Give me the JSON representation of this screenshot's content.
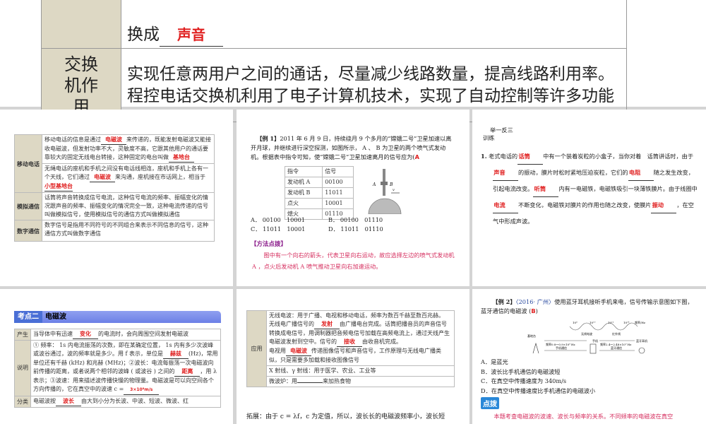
{
  "top_table": {
    "row0_tail": "换成",
    "row0_answer": "声音",
    "row1_header": "交换机作用",
    "row1_text": "实现任意两用户之间的通话，尽量减少线路数量，提高线路利用率。程控电话交换机利用了电子计算机技术，实现了自动控制等许多功能"
  },
  "slide1": {
    "rows": [
      {
        "header": "移动电话",
        "cells": [
          {
            "a": "移动电话的信息是通过",
            "ans1": "电磁波",
            "b": "来传递的，既能发射电磁波又能接收电磁波，但发射功率不大，灵敏度不高，它跟其他用户的通话要靠较大的固定无线电台转接，这种固定的电台叫做",
            "ans2": "基地台"
          },
          {
            "a": "无绳电话的座机和手机之间没有电话线相连，座机和手机上各有一个天线，它们通过",
            "ans1": "电磁波",
            "b": "来沟通，座机接在市话网上，相当于",
            "ans2": "小型基地台"
          }
        ]
      },
      {
        "header": "模拟通信",
        "text": "话筒将声音转换成信号电流，这种信号电流的频率、振幅变化的情况跟声音的频率、振幅变化的情况完全一致，这种电流传递的信号叫做模拟信号，使用模拟信号的通信方式叫做模拟通信"
      },
      {
        "header": "数字通信",
        "text": "数字信号是指用不同符号的不同组合来表示不同信息的信号，这种通信方式叫做数字通信"
      }
    ]
  },
  "slide2": {
    "label": "【例 1】",
    "stem": "2011 年 6 月 9 日，持续绕月 9 个多月的“嫦娥二号”卫星加速以离开月球，并继续进行深空探测，如图所示， A 、 B 为卫星的两个喷气式发动机。根据表中指令可知，使“嫦娥二号”卫星加速离月的信号应为(",
    "answer": "A",
    "close": ")",
    "table_headers": [
      "指令",
      "信号"
    ],
    "table_rows": [
      [
        "发动机 A",
        "00100"
      ],
      [
        "发动机 B",
        "11011"
      ],
      [
        "点火",
        "10001"
      ],
      [
        "熄火",
        "01110"
      ]
    ],
    "figure_labels": {
      "a": "A",
      "b": "B",
      "v": "v"
    },
    "options": [
      {
        "k": "A．",
        "v1": "00100",
        "v2": "10001"
      },
      {
        "k": "B．",
        "v1": "00100",
        "v2": "01110"
      },
      {
        "k": "C．",
        "v1": "11011",
        "v2": "10001"
      },
      {
        "k": "D．",
        "v1": "11011",
        "v2": "01110"
      }
    ],
    "method_title": "【方法点拨】",
    "method_text": "图中有一个向右的箭头，代表卫星向右运动，故应选择左边的喷气式发动机 A ，点火后发动机 A 喷气推动卫星向右加速运动。"
  },
  "slide3": {
    "heading1": "举一反三",
    "heading2": "训练",
    "num": "1.",
    "parts": [
      "老式电话的",
      "中有一个装着炭粒的小盒子，当你对着　话筒讲话时，由于",
      "的振动，膜片时松时紧地压迫炭粒，它们的",
      "随之发生改变，引起电流改变。",
      "内有一电磁铁，电磁铁吸引一块薄铁膜片。由于线圈中",
      "不断变化，电磁铁对膜片的作用也随之改变，使膜片",
      "，在空气中形成声波。"
    ],
    "answers": [
      "话筒",
      "声音",
      "电阻",
      "听筒",
      "电流",
      "振动"
    ]
  },
  "slide4": {
    "tag": "考点二",
    "title": "电磁波",
    "rows": [
      {
        "header": "产生",
        "a": "当导体中有迅速",
        "ans": "变化",
        "b": "的电流时，会向周围空间发射电磁波"
      },
      {
        "header": "说明",
        "a": "① 频率： 1s 内电流振荡的次数，即在某确定位置， 1s 内有多少次波峰或波谷通过，波的频率就是多少。用 f 表示，单位是",
        "ans1": "赫兹",
        "b": "(Hz)，常用单位还有千赫 (kHz) 和兆赫 (MHz)；②波长：电流每振荡一次电磁波向前传播的距离，或者说两个相邻的波峰 ( 或波谷 ) 之间的",
        "ans2": "距离",
        "c": "，用 λ 表示；③波速：用来描述波传播快慢的物理量。电磁波是可以向空间各个方向传播的，它在真空中的波速 c =",
        "ans3": "3×10⁸m/s"
      },
      {
        "header": "分类",
        "a": "电磁波按",
        "ans": "波长",
        "b": "由大到小分为长波、中波、短波、微波、红"
      }
    ]
  },
  "slide5": {
    "header": "应用",
    "p1": "无线电波：用于广播、电视和移动电话，频率为数百千赫至数百兆赫。",
    "p2a": "无线电广播信号的",
    "ans1": "发射",
    "p2b": "由广播电台完成。话筒把播音员的声音信号转换成电信号，用调制器把音频电信号加载在高频电流上，通过天线产生电磁波发射到空中。信号的",
    "ans2": "接收",
    "p2c": "由收音机完成。",
    "p3a": "电视用",
    "ans3": "电磁波",
    "p3b": "传递图像信号和声音信号，工作原理与无线电广播类似，只是需要多加载和接收图像信号",
    "p4": "X 射线、γ 射线：用于医学、农业、工业等",
    "p5a": "微波炉：用",
    "p5b": "来加热食物",
    "footer": "拓展：由于 c = λf，c 为定值，所以，波长长的电磁波频率小，波长短"
  },
  "slide6": {
    "label": "【例 2】",
    "source": "〈2016· 广州〉",
    "stem": "使用蓝牙耳机接听手机来电，信号传输示意图如下图，蓝牙通信的电磁波 (",
    "answer": "B",
    "close": ")",
    "figure": {
      "ticks": [
        "10⁸",
        "10¹⁰",
        "10¹²",
        "10¹⁴"
      ],
      "axis": "频率/Hz",
      "band1": "无线电波",
      "band2": "红外线",
      "station": "基地台",
      "phone": "手机",
      "earphone": "蓝牙耳机",
      "link1": "频率0.8～0.9×10⁹ Hz",
      "link1b": "手机通信",
      "link2": "频率2.4～2.48×10⁹ Hz",
      "link2b": "蓝牙通信"
    },
    "options": [
      "A．是蓝光",
      "B．波长比手机通信的电磁波短",
      "C．在真空中传播速度为 340m/s",
      "D．在真空中传播速度比手机通信的电磁波小"
    ],
    "tip_label": "点拨",
    "tip_text": "本题考查电磁波的波速、波长与频率的关系。不同频率的电磁波在真空"
  }
}
